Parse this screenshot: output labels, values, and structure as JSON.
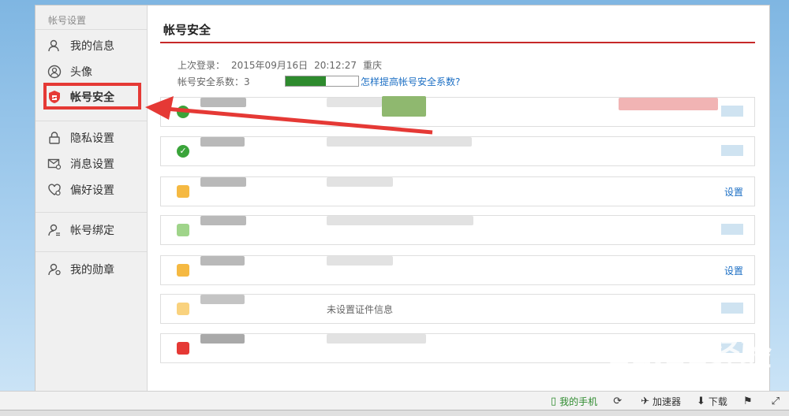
{
  "sidebar": {
    "title": "帐号设置",
    "items": [
      {
        "label": "我的信息",
        "icon": "person-icon"
      },
      {
        "label": "头像",
        "icon": "avatar-circle-icon"
      },
      {
        "label": "帐号安全",
        "icon": "shield-icon",
        "active": true
      },
      {
        "label": "隐私设置",
        "icon": "lock-icon"
      },
      {
        "label": "消息设置",
        "icon": "mail-settings-icon"
      },
      {
        "label": "偏好设置",
        "icon": "heart-gear-icon"
      },
      {
        "label": "帐号绑定",
        "icon": "person-link-icon"
      },
      {
        "label": "我的勋章",
        "icon": "person-medal-icon"
      }
    ]
  },
  "main": {
    "title": "帐号安全",
    "last_login_label": "上次登录：",
    "last_login_date": "2015年09月16日",
    "last_login_time": "20:12:27",
    "last_login_location": "重庆",
    "security_level_label": "帐号安全系数：",
    "security_level_value": "3",
    "security_level_fraction": 0.55,
    "improve_link": "怎样提高帐号安全系数?",
    "rows": [
      {
        "icon": "green-check-icon",
        "action": ""
      },
      {
        "icon": "green-check-icon",
        "action": ""
      },
      {
        "icon": "yellow-warning-icon",
        "action": "设置"
      },
      {
        "icon": "green-bar-icon",
        "action": ""
      },
      {
        "icon": "yellow-warning-icon",
        "action": "设置"
      },
      {
        "icon": "yellow-warning-icon",
        "action": "",
        "text": "未设置证件信息"
      },
      {
        "icon": "red-app-icon",
        "action": ""
      }
    ]
  },
  "statusbar": {
    "phone": "我的手机",
    "accelerator": "加速器",
    "download": "下载"
  },
  "watermark": {
    "main": "Baidu经验",
    "sub": "jingyan.baidu.com"
  },
  "colors": {
    "accent_red": "#c62828",
    "highlight_red": "#e53935",
    "link_blue": "#1c6fc4",
    "ok_green": "#2e8b2e"
  }
}
